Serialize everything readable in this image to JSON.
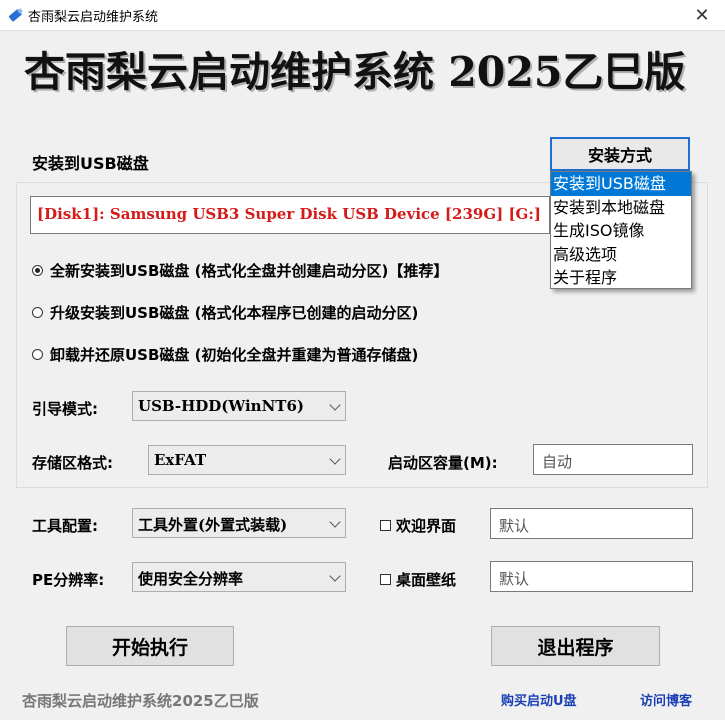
{
  "window": {
    "title": "杏雨梨云启动维护系统",
    "close_glyph": "✕"
  },
  "banner": {
    "title": "杏雨梨云启动维护系统 2025乙巳版"
  },
  "install": {
    "section_label": "安装到USB磁盘",
    "mode_button": "安装方式",
    "mode_options": [
      "安装到USB磁盘",
      "安装到本地磁盘",
      "生成ISO镜像",
      "高级选项",
      "关于程序"
    ],
    "selected_mode_index": 0,
    "disk_value": "[Disk1]:  Samsung USB3 Super Disk USB Device  [239G]  [G:]",
    "options": [
      {
        "label": "全新安装到USB磁盘 (格式化全盘并创建启动分区)【推荐】",
        "selected": true
      },
      {
        "label": "升级安装到USB磁盘 (格式化本程序已创建的启动分区)",
        "selected": false
      },
      {
        "label": "卸载并还原USB磁盘 (初始化全盘并重建为普通存储盘)",
        "selected": false
      }
    ]
  },
  "settings": {
    "boot_mode_label": "引导模式:",
    "boot_mode_value": "USB-HDD(WinNT6)",
    "storage_format_label": "存储区格式:",
    "storage_format_value": "ExFAT",
    "boot_size_label": "启动区容量(M):",
    "boot_size_value": "自动",
    "tools_label": "工具配置:",
    "tools_value": "工具外置(外置式装载)",
    "welcome_label": "欢迎界面",
    "welcome_checked": false,
    "welcome_value": "默认",
    "resolution_label": "PE分辨率:",
    "resolution_value": "使用安全分辨率",
    "wallpaper_label": "桌面壁纸",
    "wallpaper_checked": false,
    "wallpaper_value": "默认"
  },
  "actions": {
    "start_label": "开始执行",
    "exit_label": "退出程序"
  },
  "footer": {
    "text": "杏雨梨云启动维护系统2025乙巳版",
    "buy_link": "购买启动U盘",
    "blog_link": "访问博客"
  },
  "colors": {
    "accent": "#0078d7",
    "disk_text": "#d41a1a",
    "link": "#1a3fb5"
  }
}
